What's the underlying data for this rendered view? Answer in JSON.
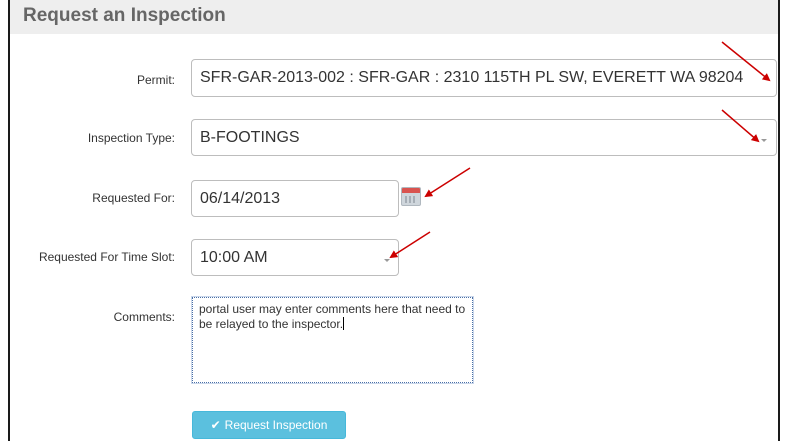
{
  "header": {
    "title": "Request an Inspection"
  },
  "form": {
    "permit": {
      "label": "Permit:",
      "value": "SFR-GAR-2013-002 : SFR-GAR : 2310 115TH PL SW, EVERETT WA 98204"
    },
    "inspection_type": {
      "label": "Inspection Type:",
      "value": "B-FOOTINGS"
    },
    "requested_for": {
      "label": "Requested For:",
      "value": "06/14/2013",
      "icon": "calendar-icon"
    },
    "time_slot": {
      "label": "Requested For Time Slot:",
      "value": "10:00 AM"
    },
    "comments": {
      "label": "Comments:",
      "value": "portal user may enter comments here that need to be relayed to the inspector."
    },
    "submit": {
      "label": "Request Inspection",
      "icon": "check-icon"
    }
  },
  "colors": {
    "header_bg": "#eeeeee",
    "button_bg": "#5bc0de",
    "annotation_arrow": "#cc0000"
  }
}
